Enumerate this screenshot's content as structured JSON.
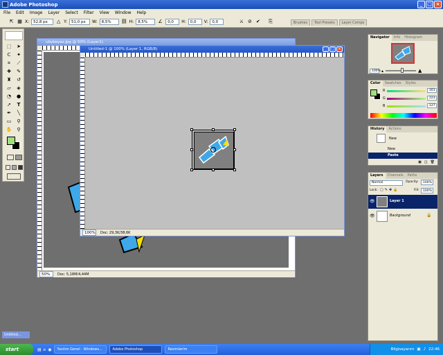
{
  "app_title": "Adobe Photoshop",
  "menu": [
    "File",
    "Edit",
    "Image",
    "Layer",
    "Select",
    "Filter",
    "View",
    "Window",
    "Help"
  ],
  "options": {
    "x_label": "X:",
    "x_value": "52,8 px",
    "y_label": "Y:",
    "y_value": "51,0 px",
    "w_label": "W:",
    "w_value": "8,5%",
    "h_label": "H:",
    "h_value": "8,5%",
    "angle_value": "0,0",
    "hskew_label": "H:",
    "hskew_value": "0,0",
    "vskew_label": "V:",
    "vskew_value": "0,0"
  },
  "palette_well_tabs": [
    "Brushes",
    "Tool Presets",
    "Layer Comps"
  ],
  "bg_doc": {
    "title": "ubybeyaz.jpg @ 50% (Layer1)",
    "zoom": "50%",
    "doc_info": "Doc: 5,18M/4,44M"
  },
  "fg_doc": {
    "title": "Untitled-1 @ 100% (Layer 1, RGB/8)",
    "zoom": "100%",
    "doc_info": "Doc: 29,3K/38,6K"
  },
  "navigator": {
    "tabs": [
      "Navigator",
      "Info",
      "Histogram"
    ],
    "zoom": "100%"
  },
  "color": {
    "tabs": [
      "Color",
      "Swatches",
      "Styles"
    ],
    "channels": [
      {
        "label": "R",
        "value": "161"
      },
      {
        "label": "G",
        "value": "223"
      },
      {
        "label": "B",
        "value": "127"
      }
    ],
    "fg": "#a1df7f"
  },
  "history": {
    "tabs": [
      "History",
      "Actions"
    ],
    "snapshot": "New",
    "items": [
      "New",
      "Paste"
    ]
  },
  "layers": {
    "tabs": [
      "Layers",
      "Channels",
      "Paths"
    ],
    "blend": "Normal",
    "opacity_label": "Opacity:",
    "opacity": "100%",
    "fill_label": "Fill:",
    "fill": "100%",
    "lock_label": "Lock:",
    "items": [
      "Layer 1",
      "Background"
    ]
  },
  "minimized_doc": "Untitled...",
  "taskbar": {
    "start": "start",
    "buttons": [
      "Yazılım Genel - Windows...",
      "Adobe Photoshop",
      "Resimlerim"
    ],
    "tray_label": "Bilgisayarım",
    "time": "22:46"
  }
}
